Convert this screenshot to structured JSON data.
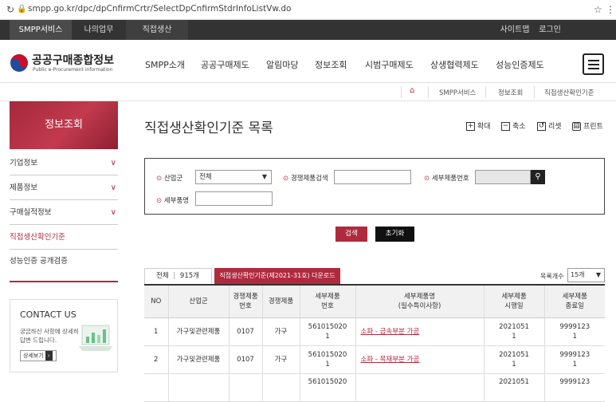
{
  "browser": {
    "url": "smpp.go.kr/dpc/dpCnfirmCrtr/SelectDpCnfirmStdrInfoListVw.do"
  },
  "topbar": {
    "tabs": [
      "SMPP서비스",
      "나의업무",
      "직접생산"
    ],
    "sitemap": "사이트맵",
    "login": "로그인"
  },
  "logo": {
    "name": "공공구매종합정보",
    "sub": "Public e-Procurement information"
  },
  "nav": [
    "SMPP소개",
    "공공구매제도",
    "알림마당",
    "정보조회",
    "시범구매제도",
    "상생협력제도",
    "성능인증제도"
  ],
  "breadcrumb": [
    "SMPP서비스",
    "정보조회",
    "직접생산확인기준"
  ],
  "sidebar": {
    "title": "정보조회",
    "items": [
      "기업정보",
      "제품정보",
      "구매실적정보",
      "직접생산확인기준",
      "성능인증 공개검증"
    ],
    "contact_title": "CONTACT US",
    "contact_text1": "궁금하신 사항에 상세히",
    "contact_text2": "답변 드립니다.",
    "contact_btn": "상세보기"
  },
  "page": {
    "title": "직접생산확인기준 목록"
  },
  "tools": [
    "확대",
    "축소",
    "리셋",
    "프린트"
  ],
  "search": {
    "industry_label": "산업군",
    "industry_value": "전체",
    "competitive_label": "경쟁제품검색",
    "detail_no_label": "세부제품번호",
    "detail_name_label": "세부품명",
    "search_btn": "검색",
    "reset_btn": "초기화"
  },
  "list": {
    "total_label": "전체",
    "total_count": "915개",
    "download_btn": "직접생산확인기준(제2021-31호) 다운로드",
    "per_page_label": "목록개수",
    "per_page_value": "15개"
  },
  "table": {
    "headers": [
      "NO",
      "산업군",
      "경쟁제품\n번호",
      "경쟁제품",
      "세부제품\n번호",
      "세부제품명\n(필수특이사항)",
      "세부제품\n시행일",
      "세부제품\n종료일"
    ],
    "rows": [
      [
        "1",
        "가구및관련제품",
        "0107",
        "가구",
        "561015020\n1",
        "소파 - 금속부분 가공",
        "2021051\n1",
        "9999123\n1"
      ],
      [
        "2",
        "가구및관련제품",
        "0107",
        "가구",
        "561015020\n1",
        "소파 - 목재부분 가공",
        "2021051\n1",
        "9999123\n1"
      ],
      [
        "",
        "",
        "",
        "",
        "561015020",
        "",
        "2021051",
        "9999123"
      ]
    ]
  }
}
